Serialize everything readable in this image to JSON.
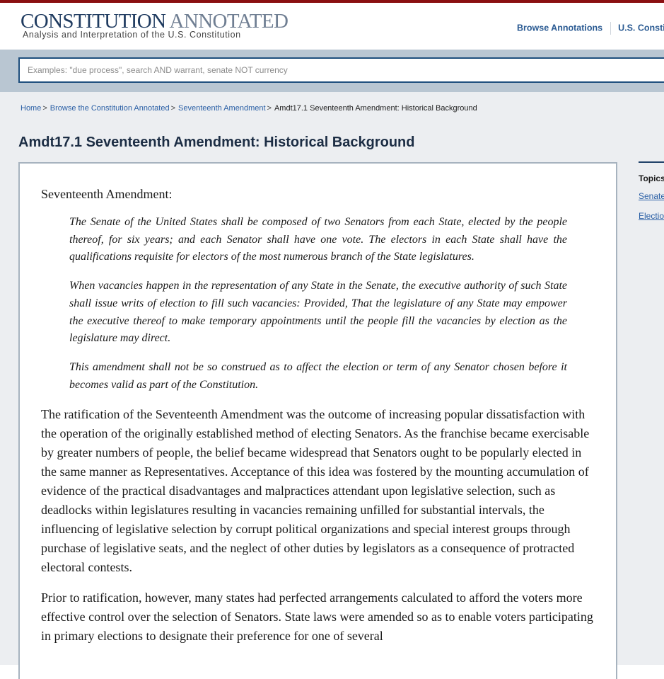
{
  "brand": {
    "title_strong": "CONSTITUTION",
    "title_light": "ANNOTATED",
    "subtitle": "Analysis and Interpretation of the U.S. Constitution",
    "accent_color": "#8a0f11"
  },
  "nav": {
    "browse_annotations": "Browse Annotations",
    "us_constitution": "U.S. Constitu"
  },
  "search": {
    "placeholder": "Examples: \"due process\", search AND warrant, senate NOT currency",
    "value": ""
  },
  "breadcrumb": {
    "items": [
      "Home",
      "Browse the Constitution Annotated",
      "Seventeenth Amendment"
    ],
    "current": "Amdt17.1 Seventeenth Amendment: Historical Background",
    "separator": ">"
  },
  "page": {
    "title": "Amdt17.1 Seventeenth Amendment: Historical Background"
  },
  "amendment": {
    "heading": "Seventeenth Amendment:",
    "clauses": [
      "The Senate of the United States shall be composed of two Senators from each State, elected by the people thereof, for six years; and each Senator shall have one vote. The electors in each State shall have the qualifications requisite for electors of the most numerous branch of the State legislatures.",
      "When vacancies happen in the representation of any State in the Senate, the executive authority of such State shall issue writs of election to fill such vacancies: Provided, That the legislature of any State may empower the executive thereof to make temporary appointments until the people fill the vacancies by election as the legislature may direct.",
      "This amendment shall not be so construed as to affect the election or term of any Senator chosen before it becomes valid as part of the Constitution."
    ]
  },
  "body": {
    "paragraphs": [
      "The ratification of the Seventeenth Amendment was the outcome of increasing popular dissatisfaction with the operation of the originally established method of electing Senators. As the franchise became exercisable by greater numbers of people, the belief became widespread that Senators ought to be popularly elected in the same manner as Representatives. Acceptance of this idea was fostered by the mounting accumulation of evidence of the practical disadvantages and malpractices attendant upon legislative selection, such as deadlocks within legislatures resulting in vacancies remaining unfilled for substantial intervals, the influencing of legislative selection by corrupt political organizations and special interest groups through purchase of legislative seats, and the neglect of other duties by legislators as a consequence of protracted electoral contests.",
      "Prior to ratification, however, many states had perfected arrangements calculated to afford the voters more effective control over the selection of Senators. State laws were amended so as to enable voters participating in primary elections to designate their preference for one of several"
    ]
  },
  "sidebar": {
    "topics_label": "Topics",
    "topics": [
      "Senate",
      "Election"
    ]
  }
}
